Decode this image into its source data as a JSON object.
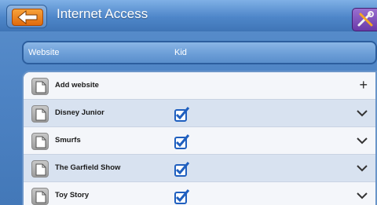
{
  "header": {
    "title": "Internet Access",
    "back_icon": "back-arrow-icon",
    "tools_icon": "wrench-screwdriver-icon"
  },
  "columns": {
    "website": "Website",
    "kid": "Kid"
  },
  "list": {
    "add_item": {
      "label": "Add website",
      "action": "+"
    },
    "items": [
      {
        "label": "Disney Junior",
        "checked": true
      },
      {
        "label": "Smurfs",
        "checked": true
      },
      {
        "label": "The Garfield Show",
        "checked": true
      },
      {
        "label": "Toy Story",
        "checked": true
      }
    ]
  },
  "colors": {
    "header_blue": "#4e86c9",
    "back_orange": "#e06a0c",
    "tools_purple": "#6a3aa8",
    "check_blue": "#1f5fbf"
  }
}
